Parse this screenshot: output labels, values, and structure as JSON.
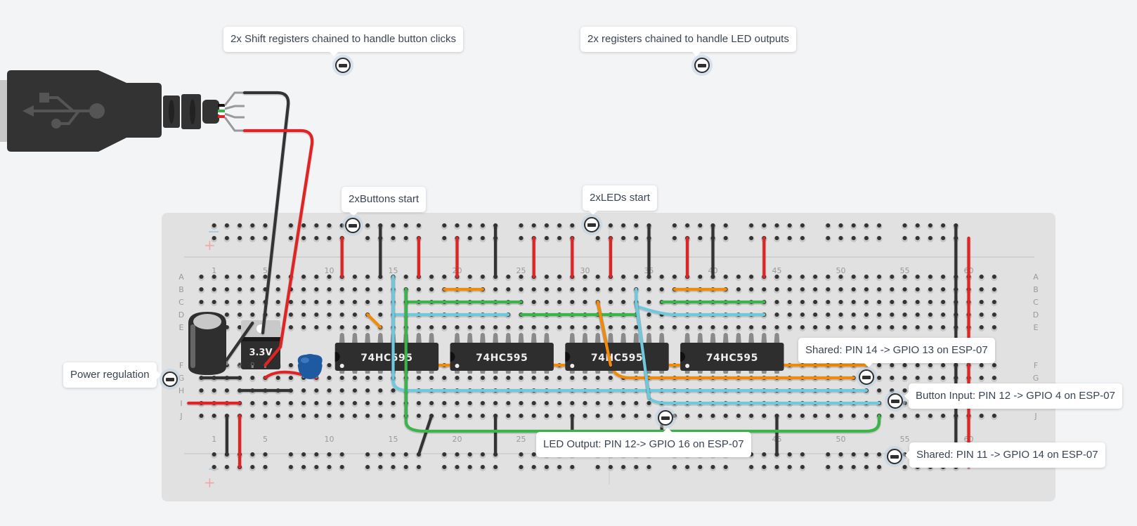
{
  "annotations": [
    {
      "id": "shift-registers-buttons",
      "text": "2x Shift registers chained to handle button clicks",
      "box": [
        318,
        38
      ],
      "pin": [
        488,
        93
      ],
      "dir": "down",
      "tip": 150
    },
    {
      "id": "registers-leds",
      "text": "2x registers chained to handle LED outputs",
      "box": [
        826,
        38
      ],
      "pin": [
        999,
        93
      ],
      "dir": "down",
      "tip": 158
    },
    {
      "id": "buttons-start",
      "text": "2xButtons start",
      "box": [
        486,
        266
      ],
      "pin": [
        502,
        321
      ],
      "dir": "down",
      "tip": 10
    },
    {
      "id": "leds-start",
      "text": "2xLEDs start",
      "box": [
        829,
        264
      ],
      "pin": [
        842,
        320
      ],
      "dir": "down",
      "tip": 8
    },
    {
      "id": "power-regulation",
      "text": "Power regulation",
      "box": [
        90,
        516
      ],
      "pin": [
        242,
        540
      ],
      "dir": "right",
      "tip": 0
    },
    {
      "id": "shared-pin14",
      "text": "Shared: PIN 14 -> GPIO 13 on ESP-07",
      "box": [
        1136,
        481
      ],
      "pin": [
        1233,
        537
      ],
      "dir": "down",
      "tip": 93
    },
    {
      "id": "button-input-pin12",
      "text": "Button Input: PIN 12 -> GPIO 4 on ESP-07",
      "box": [
        1293,
        546
      ],
      "pin": [
        1274,
        571
      ],
      "dir": "left",
      "tip": 0
    },
    {
      "id": "led-output-pin12",
      "text": "LED Output: PIN 12-> GPIO 16 on ESP-07",
      "box": [
        763,
        615
      ],
      "pin": [
        947,
        595
      ],
      "dir": "up",
      "tip": 180
    },
    {
      "id": "shared-pin11",
      "text": "Shared: PIN 11 -> GPIO 14 on ESP-07",
      "box": [
        1294,
        630
      ],
      "pin": [
        1273,
        650
      ],
      "dir": "left",
      "tip": 0
    }
  ],
  "breadboard": {
    "rows_top": [
      "A",
      "B",
      "C",
      "D",
      "E"
    ],
    "rows_bottom": [
      "F",
      "G",
      "H",
      "I",
      "J"
    ],
    "column_labels": [
      "1",
      "5",
      "10",
      "15",
      "20",
      "25",
      "30",
      "35",
      "40",
      "45",
      "50",
      "55",
      "60"
    ],
    "columns": 63,
    "rail_minus_label": "−",
    "rail_plus_label": "+"
  },
  "components": {
    "regulator_label": "3.3V",
    "regulator_pins": [
      "G",
      "O",
      "I"
    ],
    "chips": [
      "74HC595",
      "74HC595",
      "74HC595",
      "74HC595"
    ],
    "usb_connector": "usb-plug"
  },
  "colors": {
    "red": "#e02424",
    "black": "#333333",
    "green": "#3cb44b",
    "orange": "#f08a0c",
    "cyan": "#6fc8dc",
    "board": "#e1e1e1",
    "chip": "#2e2e2e",
    "capacitor_blue": "#1e5aa0"
  }
}
